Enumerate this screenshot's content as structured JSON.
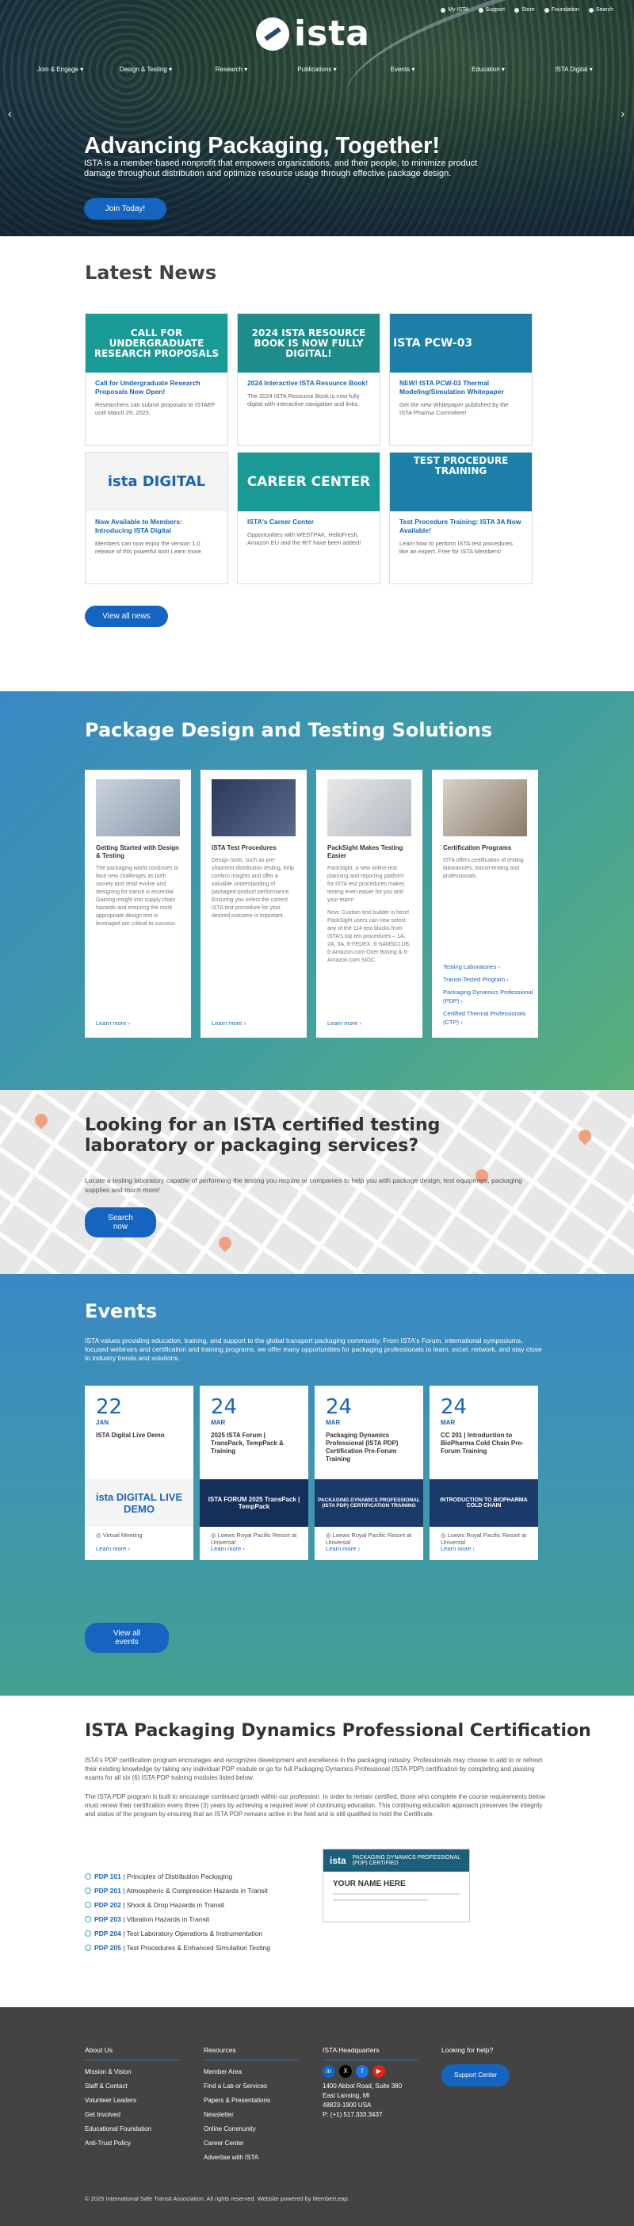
{
  "utility": [
    "My ISTA",
    "Support",
    "Store",
    "Foundation",
    "Search"
  ],
  "logo_text": "ista",
  "nav": [
    "Join & Engage",
    "Design & Testing",
    "Research",
    "Publications",
    "Events",
    "Education",
    "ISTA Digital"
  ],
  "hero": {
    "title": "Advancing Packaging, Together!",
    "subtitle": "ISTA is a member-based nonprofit that empowers organizations, and their people, to minimize product damage throughout distribution and optimize resource usage through effective package design.",
    "button": "Join Today!"
  },
  "news": {
    "title": "Latest News",
    "button": "View all news",
    "items": [
      {
        "img": "CALL FOR UNDERGRADUATE RESEARCH PROPOSALS",
        "title": "Call for Undergraduate Research Proposals Now Open!",
        "text": "Researchers can submit proposals to ISTAEF until March 29, 2025."
      },
      {
        "img": "2024 ISTA RESOURCE BOOK IS NOW FULLY DIGITAL!",
        "title": "2024 Interactive ISTA Resource Book!",
        "text": "The 2024 ISTA Resource Book is now fully digital with interactive navigation and links."
      },
      {
        "img": "ISTA PCW-03",
        "title": "NEW! ISTA PCW-03 Thermal Modeling/Simulation Whitepaper",
        "text": "Get the new Whitepaper published by the ISTA Pharma Committee!"
      },
      {
        "img": "ista DIGITAL",
        "title": "Now Available to Members: Introducing ISTA Digital",
        "text": "Members can now enjoy the version 1.0 release of this powerful tool! Learn more."
      },
      {
        "img": "CAREER CENTER",
        "title": "ISTA's Career Center",
        "text": "Opportunities with WESTPAK, HelloFresh, Amazon EU and the RIT have been added!"
      },
      {
        "img": "TEST PROCEDURE TRAINING",
        "title": "Test Procedure Training: ISTA 3A Now Available!",
        "text": "Learn how to perform ISTA test procedures like an expert. Free for ISTA Members!"
      }
    ]
  },
  "solutions": {
    "title": "Package Design and Testing Solutions",
    "cards": [
      {
        "title": "Getting Started with Design & Testing",
        "text": "The packaging world continues to face new challenges as both society and retail evolve and designing for transit is essential. Gaining insight into supply chain hazards and ensuring the most appropriate design test is leveraged are critical to success.",
        "more": "Learn more"
      },
      {
        "title": "ISTA Test Procedures",
        "text": "Design tools, such as pre-shipment distribution testing, help confirm insights and offer a valuable understanding of packaged-product performance. Ensuring you select the correct ISTA test procedure for your desired outcome is important.",
        "more": "Learn more"
      },
      {
        "title": "PackSight Makes Testing Easier",
        "text": "PackSight, a new online test planning and reporting platform for ISTA test procedures makes testing even easier for you and your team!",
        "text2": "New: Custom test builder is here! PackSight users can now select any of the 114 test blocks from ISTA's top ten procedures – 1A, 2A, 3A, 6-FEDEX, 6-SAMSCLUB, 6-Amazon.com-Over Boxing & 6-Amazon.com SIOC.",
        "more": "Learn more"
      },
      {
        "title": "Certification Programs",
        "text": "ISTA offers certification of testing laboratories, transit-testing and professionals.",
        "links": [
          "Testing Laboratories",
          "Transit-Tested Program",
          "Packaging Dynamics Professional (PDP)",
          "Certified Thermal Professionals (CTP)"
        ]
      }
    ]
  },
  "lookup": {
    "title": "Looking for an ISTA certified testing laboratory or packaging services?",
    "text": "Locate a testing laboratory capable of performing the testing you require or companies to help you with package design, test equipment, packaging supplies and much more!",
    "button": "Search now"
  },
  "events": {
    "title": "Events",
    "lead": "ISTA values providing education, training, and support to the global transport packaging community. From ISTA's Forum, international symposiums, focused webinars and certification and training programs, we offer many opportunities for packaging professionals to learn, excel, network, and stay close to industry trends and solutions.",
    "button": "View all events",
    "items": [
      {
        "day": "22",
        "mon": "JAN",
        "title": "ISTA Digital Live Demo",
        "img": "ista DIGITAL LIVE DEMO",
        "loc": "Virtual Meeting",
        "more": "Learn more"
      },
      {
        "day": "24",
        "mon": "MAR",
        "title": "2025 ISTA Forum | TransPack, TempPack & Training",
        "img": "ISTA FORUM 2025 TransPack | TempPack",
        "loc": "Loews Royal Pacific Resort at Universal",
        "more": "Learn more"
      },
      {
        "day": "24",
        "mon": "MAR",
        "title": "Packaging Dynamics Professional (ISTA PDP) Certification Pre-Forum Training",
        "img": "PACKAGING DYNAMICS PROFESSIONAL (ISTA PDP) CERTIFICATION TRAINING",
        "loc": "Loews Royal Pacific Resort at Universal",
        "more": "Learn more"
      },
      {
        "day": "24",
        "mon": "MAR",
        "title": "CC 201 | Introduction to BioPharma Cold Chain Pre-Forum Training",
        "img": "INTRODUCTION TO BIOPHARMA COLD CHAIN",
        "loc": "Loews Royal Pacific Resort at Universal",
        "more": "Learn more"
      }
    ]
  },
  "cert": {
    "title": "ISTA Packaging Dynamics Professional Certification",
    "p1": "ISTA's PDP certification program encourages and recognizes development and excellence in the packaging industry. Professionals may choose to add to or refresh their existing knowledge by taking any individual PDP module or go for full Packaging Dynamics Professional (ISTA PDP) certification by completing and passing exams for all six (6) ISTA PDP training modules listed below.",
    "p2": "The ISTA PDP program is built to encourage continued growth within our profession. In order to remain certified, those who complete the course requirements below must renew their certification every three (3) years by achieving a required level of continuing education. This continuing education approach preserves the integrity and status of the program by ensuring that an ISTA PDP remains active in the field and is still qualified to hold the Certificate.",
    "modules": [
      {
        "code": "PDP 101",
        "name": "Principles of Distribution Packaging"
      },
      {
        "code": "PDP 201",
        "name": "Atmospheric & Compression Hazards in Transit"
      },
      {
        "code": "PDP 202",
        "name": "Shock & Drop Hazards in Transit"
      },
      {
        "code": "PDP 203",
        "name": "Vibration Hazards in Transit"
      },
      {
        "code": "PDP 204",
        "name": "Test Laboratory Operations & Instrumentation"
      },
      {
        "code": "PDP 205",
        "name": "Test Procedures & Enhanced Simulation Testing"
      }
    ],
    "cert_band": "PACKAGING DYNAMICS PROFESSIONAL (PDP) CERTIFIED",
    "cert_name": "YOUR NAME HERE"
  },
  "footer": {
    "about_title": "About Us",
    "about": [
      "Mission & Vision",
      "Staff & Contact",
      "Volunteer Leaders",
      "Get Involved",
      "Educational Foundation",
      "Anti-Trust Policy"
    ],
    "res_title": "Resources",
    "res": [
      "Member Area",
      "Find a Lab or Services",
      "Papers & Presentations",
      "Newsletter",
      "Online Community",
      "Career Center",
      "Advertise with ISTA"
    ],
    "hq_title": "ISTA Headquarters",
    "addr": [
      "1400 Abbot Road, Suite 380",
      "East Lansing, MI",
      "48823-1900 USA",
      "P: (+1) 517.333.3437"
    ],
    "help_title": "Looking for help?",
    "help_btn": "Support Center",
    "copyright": "© 2025 International Safe Transit Association. All rights reserved. Website powered by MemberLeap."
  }
}
